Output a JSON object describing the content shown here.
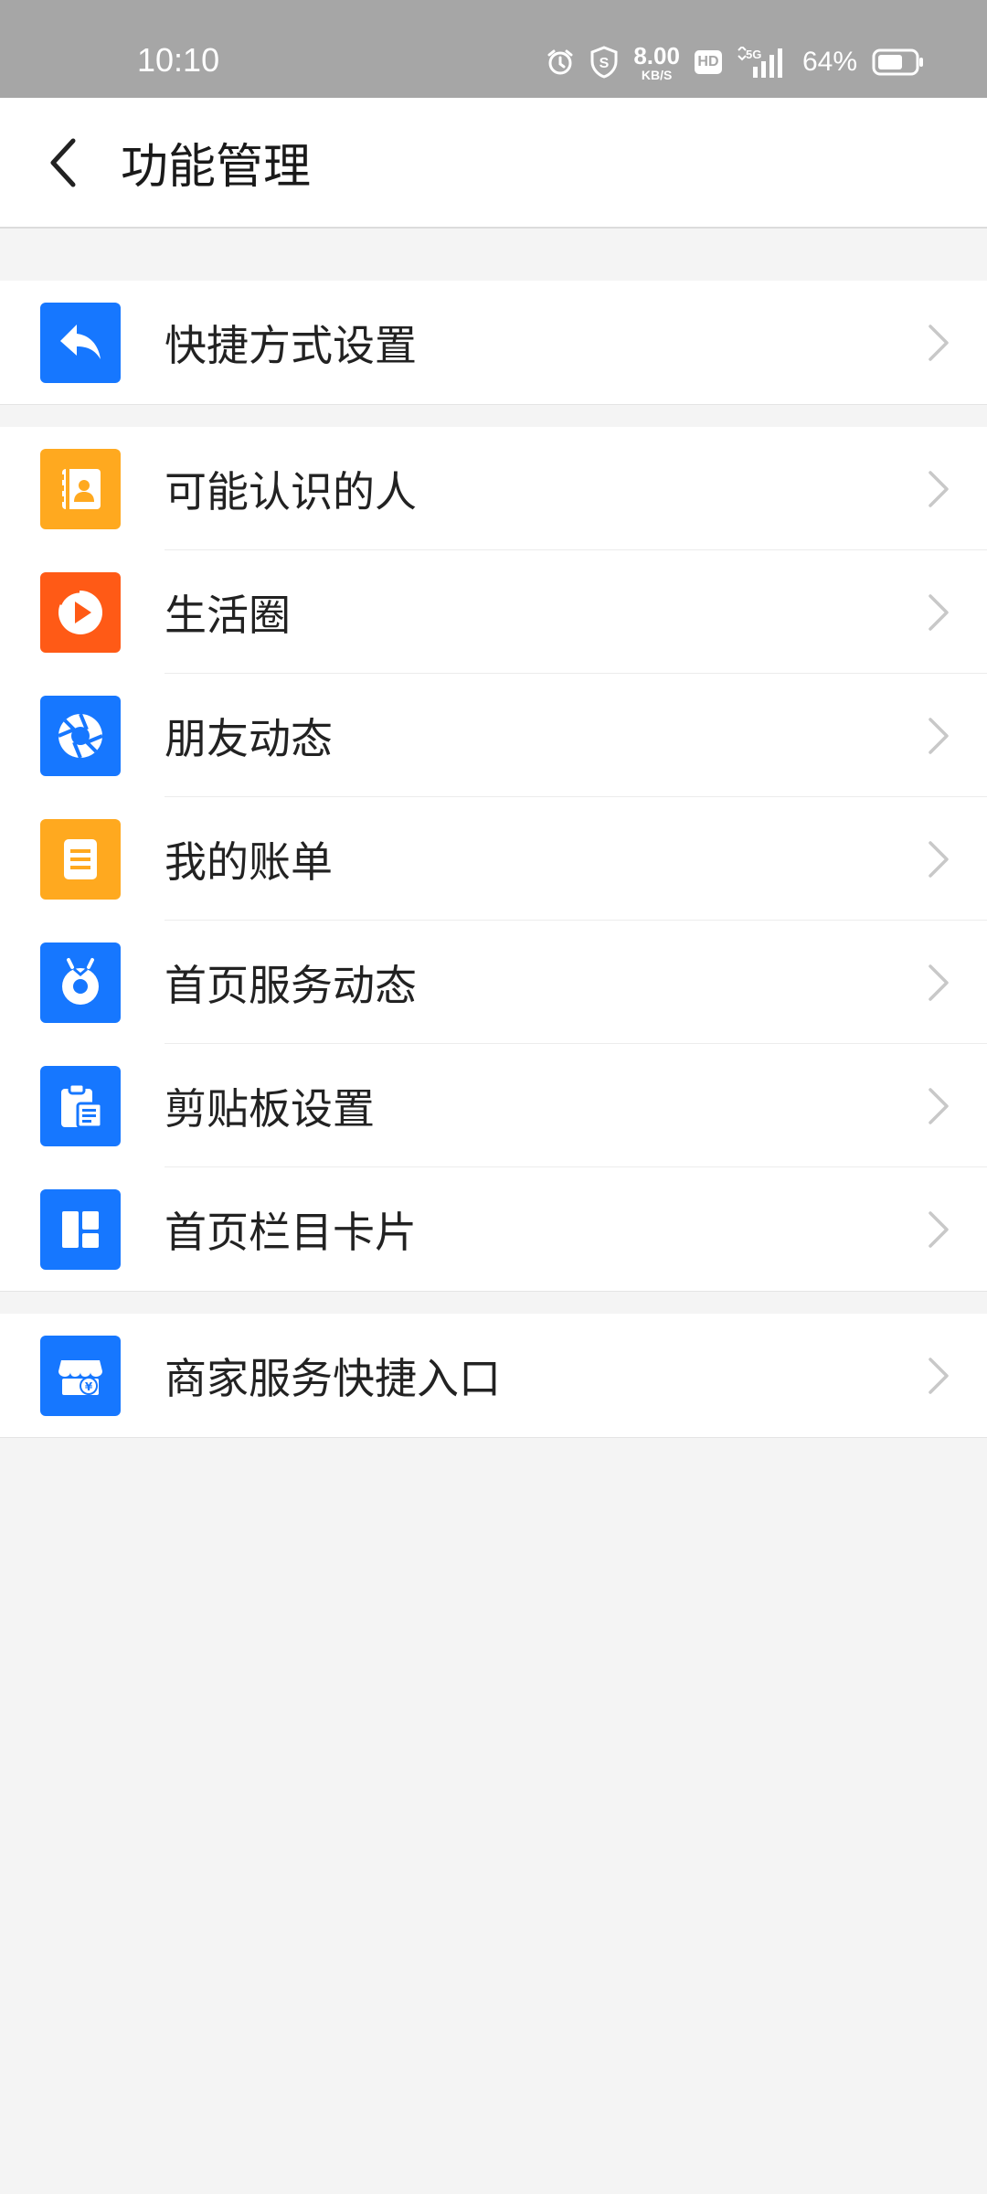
{
  "status_bar": {
    "time": "10:10",
    "speed_value": "8.00",
    "speed_unit": "KB/S",
    "hd": "HD",
    "network": "5G",
    "battery": "64%",
    "icons": [
      "alarm-icon",
      "shield-icon",
      "hd-icon",
      "signal-icon",
      "battery-icon"
    ]
  },
  "header": {
    "title": "功能管理",
    "back_icon": "back-arrow-icon"
  },
  "groups": [
    {
      "items": [
        {
          "label": "快捷方式设置",
          "icon": "shortcut-reply-icon",
          "color": "#1677ff"
        }
      ]
    },
    {
      "items": [
        {
          "label": "可能认识的人",
          "icon": "contact-card-icon",
          "color": "#ffa91f"
        },
        {
          "label": "生活圈",
          "icon": "life-circle-play-icon",
          "color": "#ff5a16"
        },
        {
          "label": "朋友动态",
          "icon": "aperture-icon",
          "color": "#1677ff"
        },
        {
          "label": "我的账单",
          "icon": "bill-document-icon",
          "color": "#ffa91f"
        },
        {
          "label": "首页服务动态",
          "icon": "service-bug-icon",
          "color": "#1677ff"
        },
        {
          "label": "剪贴板设置",
          "icon": "clipboard-icon",
          "color": "#1677ff"
        },
        {
          "label": "首页栏目卡片",
          "icon": "layout-cards-icon",
          "color": "#1677ff"
        }
      ]
    },
    {
      "items": [
        {
          "label": "商家服务快捷入口",
          "icon": "merchant-store-icon",
          "color": "#1677ff"
        }
      ]
    }
  ],
  "colors": {
    "status_bar_bg": "#a6a6a6",
    "page_bg": "#f4f4f4",
    "chevron": "#c8c8c8"
  }
}
